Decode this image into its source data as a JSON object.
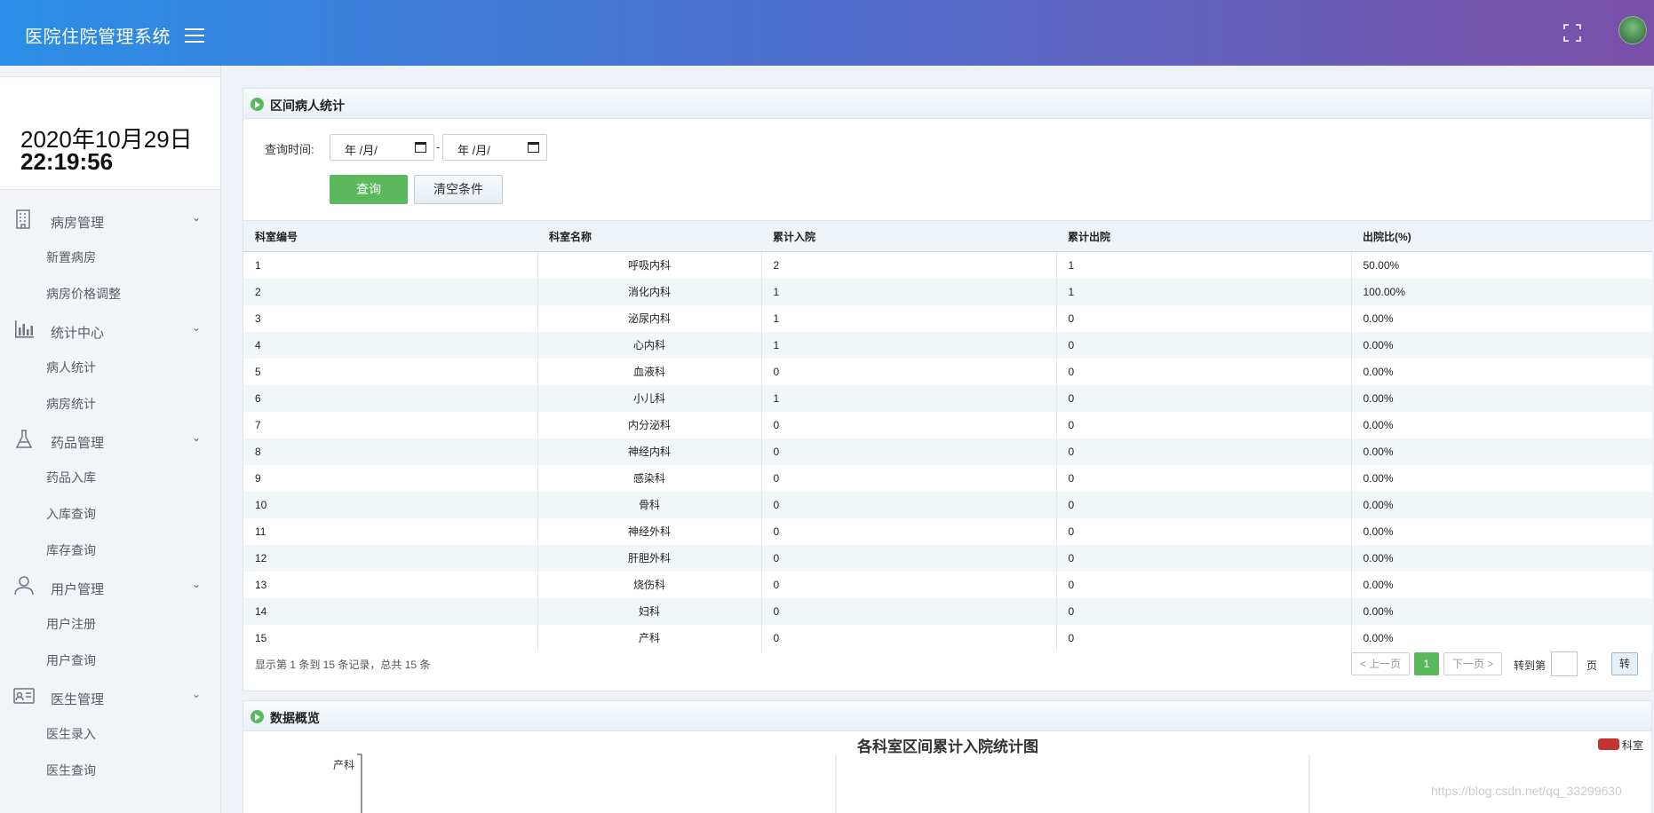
{
  "header": {
    "app_title": "医院住院管理系统",
    "menu_icon": "hamburger-icon",
    "fullscreen_icon": "fullscreen-icon"
  },
  "sidebar": {
    "date": "2020年10月29日",
    "time": "22:19:56",
    "groups": [
      {
        "label": "病房管理",
        "icon": "building-icon",
        "items": [
          "新置病房",
          "病房价格调整"
        ]
      },
      {
        "label": "统计中心",
        "icon": "bar-chart-icon",
        "items": [
          "病人统计",
          "病房统计"
        ]
      },
      {
        "label": "药品管理",
        "icon": "flask-icon",
        "items": [
          "药品入库",
          "入库查询",
          "库存查询"
        ]
      },
      {
        "label": "用户管理",
        "icon": "user-icon",
        "items": [
          "用户注册",
          "用户查询"
        ]
      },
      {
        "label": "医生管理",
        "icon": "id-card-icon",
        "items": [
          "医生录入",
          "医生查询"
        ]
      }
    ]
  },
  "stats_panel": {
    "title": "区间病人统计",
    "query_label": "查询时间:",
    "date_placeholder": "年 /月/",
    "separator": "-",
    "query_button": "查询",
    "clear_button": "清空条件",
    "columns": [
      "科室编号",
      "科室名称",
      "累计入院",
      "累计出院",
      "出院比(%)"
    ],
    "rows": [
      [
        "1",
        "呼吸内科",
        "2",
        "1",
        "50.00%"
      ],
      [
        "2",
        "消化内科",
        "1",
        "1",
        "100.00%"
      ],
      [
        "3",
        "泌尿内科",
        "1",
        "0",
        "0.00%"
      ],
      [
        "4",
        "心内科",
        "1",
        "0",
        "0.00%"
      ],
      [
        "5",
        "血液科",
        "0",
        "0",
        "0.00%"
      ],
      [
        "6",
        "小儿科",
        "1",
        "0",
        "0.00%"
      ],
      [
        "7",
        "内分泌科",
        "0",
        "0",
        "0.00%"
      ],
      [
        "8",
        "神经内科",
        "0",
        "0",
        "0.00%"
      ],
      [
        "9",
        "感染科",
        "0",
        "0",
        "0.00%"
      ],
      [
        "10",
        "骨科",
        "0",
        "0",
        "0.00%"
      ],
      [
        "11",
        "神经外科",
        "0",
        "0",
        "0.00%"
      ],
      [
        "12",
        "肝胆外科",
        "0",
        "0",
        "0.00%"
      ],
      [
        "13",
        "烧伤科",
        "0",
        "0",
        "0.00%"
      ],
      [
        "14",
        "妇科",
        "0",
        "0",
        "0.00%"
      ],
      [
        "15",
        "产科",
        "0",
        "0",
        "0.00%"
      ]
    ],
    "pager": {
      "info": "显示第 1 条到 15 条记录，总共 15 条",
      "prev": "< 上一页",
      "current": "1",
      "next": "下一页 >",
      "goto_label": "转到第",
      "page_unit": "页",
      "goto_button": "转"
    }
  },
  "overview_panel": {
    "title": "数据概览",
    "watermark": "https://blog.csdn.net/qq_33299630"
  },
  "chart_data": {
    "type": "bar",
    "title": "各科室区间累计入院统计图",
    "legend": [
      "科室"
    ],
    "legend_position": "top-right",
    "series_color": "#c23531",
    "categories": [
      "产科"
    ],
    "visible_category_labels": [
      "产科"
    ]
  }
}
